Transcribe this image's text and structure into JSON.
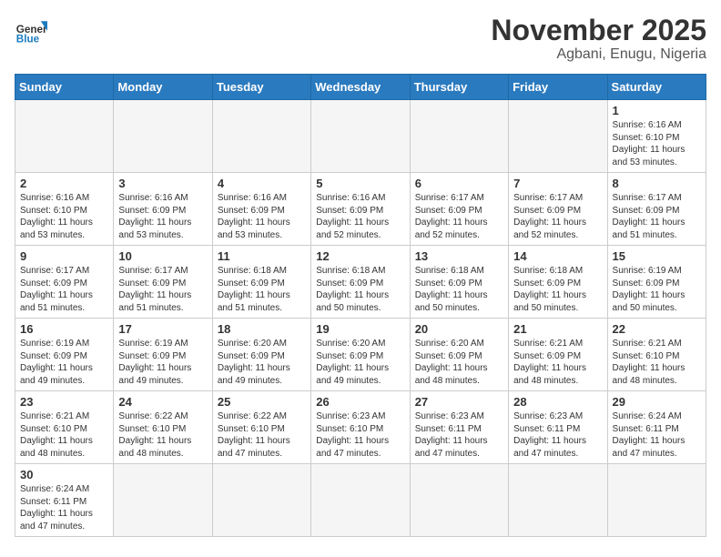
{
  "header": {
    "logo_general": "General",
    "logo_blue": "Blue",
    "month_title": "November 2025",
    "location": "Agbani, Enugu, Nigeria"
  },
  "weekdays": [
    "Sunday",
    "Monday",
    "Tuesday",
    "Wednesday",
    "Thursday",
    "Friday",
    "Saturday"
  ],
  "weeks": [
    [
      {
        "day": "",
        "info": ""
      },
      {
        "day": "",
        "info": ""
      },
      {
        "day": "",
        "info": ""
      },
      {
        "day": "",
        "info": ""
      },
      {
        "day": "",
        "info": ""
      },
      {
        "day": "",
        "info": ""
      },
      {
        "day": "1",
        "info": "Sunrise: 6:16 AM\nSunset: 6:10 PM\nDaylight: 11 hours\nand 53 minutes."
      }
    ],
    [
      {
        "day": "2",
        "info": "Sunrise: 6:16 AM\nSunset: 6:10 PM\nDaylight: 11 hours\nand 53 minutes."
      },
      {
        "day": "3",
        "info": "Sunrise: 6:16 AM\nSunset: 6:09 PM\nDaylight: 11 hours\nand 53 minutes."
      },
      {
        "day": "4",
        "info": "Sunrise: 6:16 AM\nSunset: 6:09 PM\nDaylight: 11 hours\nand 53 minutes."
      },
      {
        "day": "5",
        "info": "Sunrise: 6:16 AM\nSunset: 6:09 PM\nDaylight: 11 hours\nand 52 minutes."
      },
      {
        "day": "6",
        "info": "Sunrise: 6:17 AM\nSunset: 6:09 PM\nDaylight: 11 hours\nand 52 minutes."
      },
      {
        "day": "7",
        "info": "Sunrise: 6:17 AM\nSunset: 6:09 PM\nDaylight: 11 hours\nand 52 minutes."
      },
      {
        "day": "8",
        "info": "Sunrise: 6:17 AM\nSunset: 6:09 PM\nDaylight: 11 hours\nand 51 minutes."
      }
    ],
    [
      {
        "day": "9",
        "info": "Sunrise: 6:17 AM\nSunset: 6:09 PM\nDaylight: 11 hours\nand 51 minutes."
      },
      {
        "day": "10",
        "info": "Sunrise: 6:17 AM\nSunset: 6:09 PM\nDaylight: 11 hours\nand 51 minutes."
      },
      {
        "day": "11",
        "info": "Sunrise: 6:18 AM\nSunset: 6:09 PM\nDaylight: 11 hours\nand 51 minutes."
      },
      {
        "day": "12",
        "info": "Sunrise: 6:18 AM\nSunset: 6:09 PM\nDaylight: 11 hours\nand 50 minutes."
      },
      {
        "day": "13",
        "info": "Sunrise: 6:18 AM\nSunset: 6:09 PM\nDaylight: 11 hours\nand 50 minutes."
      },
      {
        "day": "14",
        "info": "Sunrise: 6:18 AM\nSunset: 6:09 PM\nDaylight: 11 hours\nand 50 minutes."
      },
      {
        "day": "15",
        "info": "Sunrise: 6:19 AM\nSunset: 6:09 PM\nDaylight: 11 hours\nand 50 minutes."
      }
    ],
    [
      {
        "day": "16",
        "info": "Sunrise: 6:19 AM\nSunset: 6:09 PM\nDaylight: 11 hours\nand 49 minutes."
      },
      {
        "day": "17",
        "info": "Sunrise: 6:19 AM\nSunset: 6:09 PM\nDaylight: 11 hours\nand 49 minutes."
      },
      {
        "day": "18",
        "info": "Sunrise: 6:20 AM\nSunset: 6:09 PM\nDaylight: 11 hours\nand 49 minutes."
      },
      {
        "day": "19",
        "info": "Sunrise: 6:20 AM\nSunset: 6:09 PM\nDaylight: 11 hours\nand 49 minutes."
      },
      {
        "day": "20",
        "info": "Sunrise: 6:20 AM\nSunset: 6:09 PM\nDaylight: 11 hours\nand 48 minutes."
      },
      {
        "day": "21",
        "info": "Sunrise: 6:21 AM\nSunset: 6:09 PM\nDaylight: 11 hours\nand 48 minutes."
      },
      {
        "day": "22",
        "info": "Sunrise: 6:21 AM\nSunset: 6:10 PM\nDaylight: 11 hours\nand 48 minutes."
      }
    ],
    [
      {
        "day": "23",
        "info": "Sunrise: 6:21 AM\nSunset: 6:10 PM\nDaylight: 11 hours\nand 48 minutes."
      },
      {
        "day": "24",
        "info": "Sunrise: 6:22 AM\nSunset: 6:10 PM\nDaylight: 11 hours\nand 48 minutes."
      },
      {
        "day": "25",
        "info": "Sunrise: 6:22 AM\nSunset: 6:10 PM\nDaylight: 11 hours\nand 47 minutes."
      },
      {
        "day": "26",
        "info": "Sunrise: 6:23 AM\nSunset: 6:10 PM\nDaylight: 11 hours\nand 47 minutes."
      },
      {
        "day": "27",
        "info": "Sunrise: 6:23 AM\nSunset: 6:11 PM\nDaylight: 11 hours\nand 47 minutes."
      },
      {
        "day": "28",
        "info": "Sunrise: 6:23 AM\nSunset: 6:11 PM\nDaylight: 11 hours\nand 47 minutes."
      },
      {
        "day": "29",
        "info": "Sunrise: 6:24 AM\nSunset: 6:11 PM\nDaylight: 11 hours\nand 47 minutes."
      }
    ],
    [
      {
        "day": "30",
        "info": "Sunrise: 6:24 AM\nSunset: 6:11 PM\nDaylight: 11 hours\nand 47 minutes."
      },
      {
        "day": "",
        "info": ""
      },
      {
        "day": "",
        "info": ""
      },
      {
        "day": "",
        "info": ""
      },
      {
        "day": "",
        "info": ""
      },
      {
        "day": "",
        "info": ""
      },
      {
        "day": "",
        "info": ""
      }
    ]
  ]
}
